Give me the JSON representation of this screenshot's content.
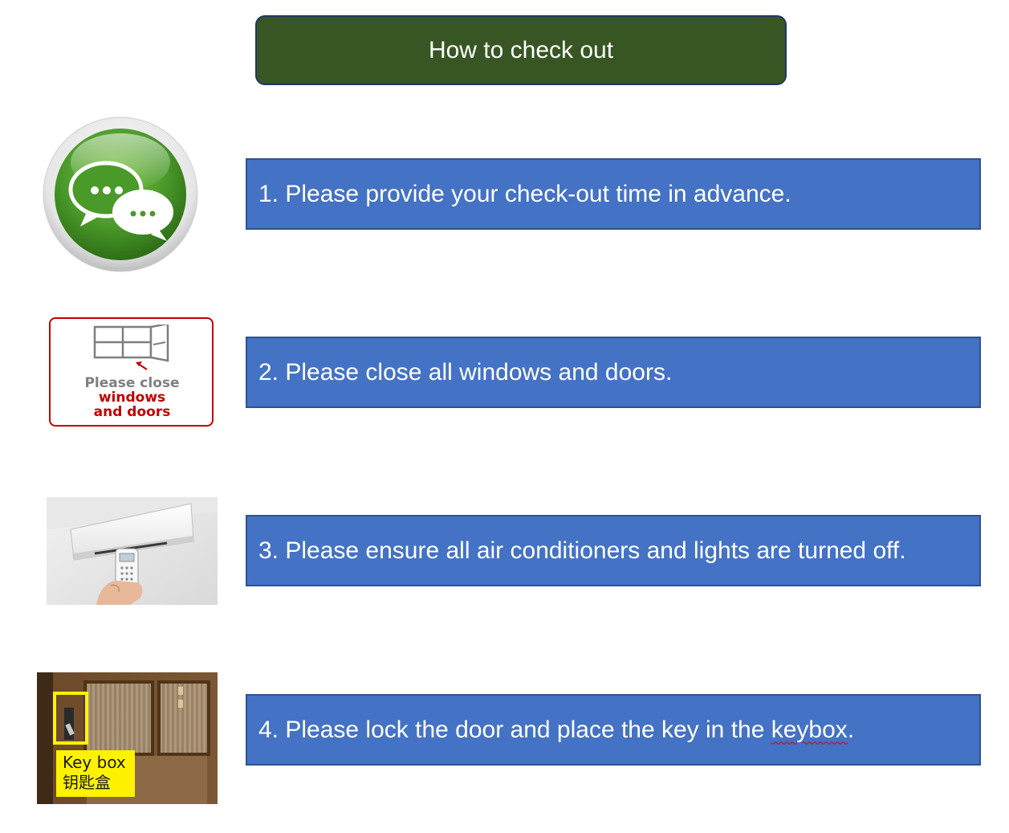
{
  "title": "How to check out",
  "steps": [
    {
      "text": "1. Please provide your check-out time in advance.",
      "icon": "chat-bubbles-icon"
    },
    {
      "text": "2. Please close all windows and doors.",
      "icon": "close-windows-sign"
    },
    {
      "text": "3. Please ensure all air conditioners and lights are turned off.",
      "icon": "air-conditioner-photo"
    },
    {
      "text_before": "4. Please lock the door and place the key in the ",
      "text_flagged": "keybox",
      "text_after": ".",
      "icon": "keybox-photo"
    }
  ],
  "window_sign": {
    "line1": "Please close",
    "line2": "windows",
    "line3": "and doors"
  },
  "keybox": {
    "label_en": "Key box",
    "label_zh": "钥匙盒"
  },
  "colors": {
    "title_bg": "#375623",
    "step_bg": "#4472c4",
    "step_border": "#2f528f",
    "sign_red": "#c00000",
    "keybox_highlight": "#fff200"
  }
}
